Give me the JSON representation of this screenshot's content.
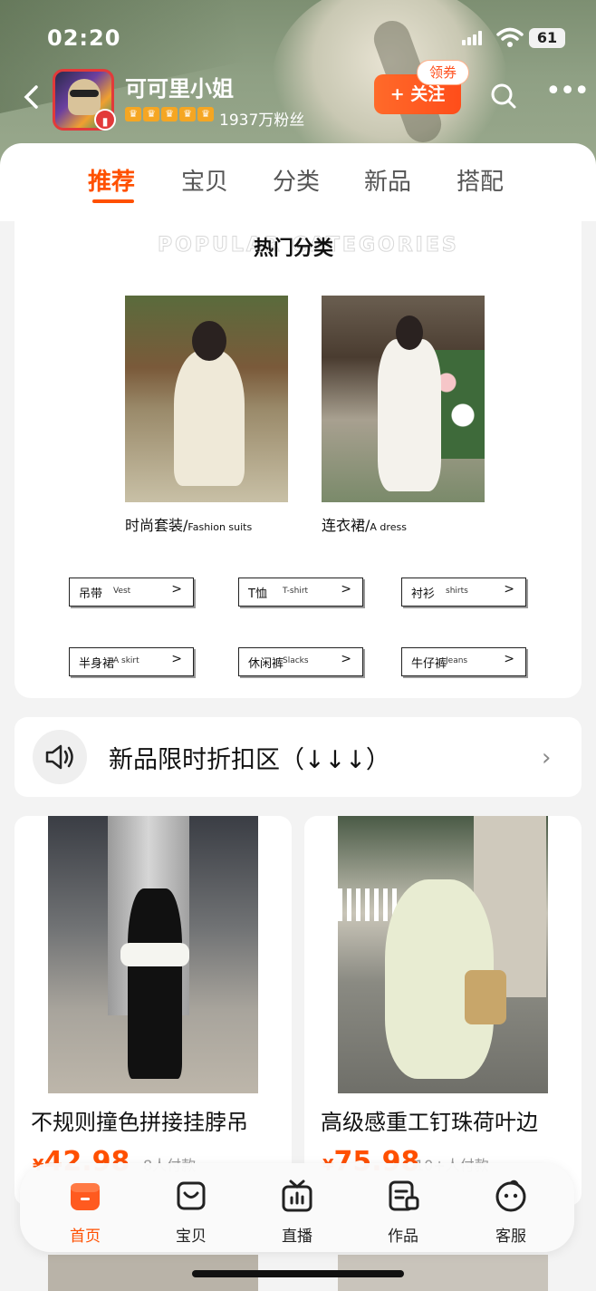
{
  "status_bar": {
    "time": "02:20",
    "battery": "61"
  },
  "shop": {
    "name": "可可里小姐",
    "fans": "1937万粉丝",
    "follow_label": "+ 关注",
    "coupon_label": "领券"
  },
  "tabs": [
    {
      "label": "推荐",
      "active": true
    },
    {
      "label": "宝贝"
    },
    {
      "label": "分类"
    },
    {
      "label": "新品"
    },
    {
      "label": "搭配"
    }
  ],
  "categories": {
    "title_ghost": "POPULAR CATEGORIES",
    "title": "热门分类",
    "featured": [
      {
        "cn": "时尚套装/",
        "en": "Fashion suits"
      },
      {
        "cn": "连衣裙/",
        "en": "A dress"
      }
    ],
    "chips": [
      {
        "cn": "吊带",
        "en": "Vest",
        "arrow": ">"
      },
      {
        "cn": "T恤",
        "en": "T-shirt",
        "arrow": ">"
      },
      {
        "cn": "衬衫",
        "en": "shirts",
        "arrow": ">"
      },
      {
        "cn": "半身裙",
        "en": "A skirt",
        "arrow": ">"
      },
      {
        "cn": "休闲裤",
        "en": "Slacks",
        "arrow": ">"
      },
      {
        "cn": "牛仔裤",
        "en": "Jeans",
        "arrow": ">"
      }
    ]
  },
  "notice": {
    "text": "新品限时折扣区（↓↓↓）",
    "chevron": "›"
  },
  "products": [
    {
      "title": "不规则撞色拼接挂脖吊",
      "currency": "¥",
      "price": "42.98",
      "sold": "8人付款"
    },
    {
      "title": "高级感重工钉珠荷叶边",
      "currency": "¥",
      "price": "75.98",
      "sold": "10+人付款"
    }
  ],
  "bottom_nav": [
    {
      "label": "首页",
      "icon": "shop-home-icon",
      "active": true
    },
    {
      "label": "宝贝",
      "icon": "bag-icon"
    },
    {
      "label": "直播",
      "icon": "live-tv-icon"
    },
    {
      "label": "作品",
      "icon": "works-icon"
    },
    {
      "label": "客服",
      "icon": "service-icon"
    }
  ],
  "colors": {
    "accent": "#ff5000",
    "follow": "#ff4d1a"
  }
}
